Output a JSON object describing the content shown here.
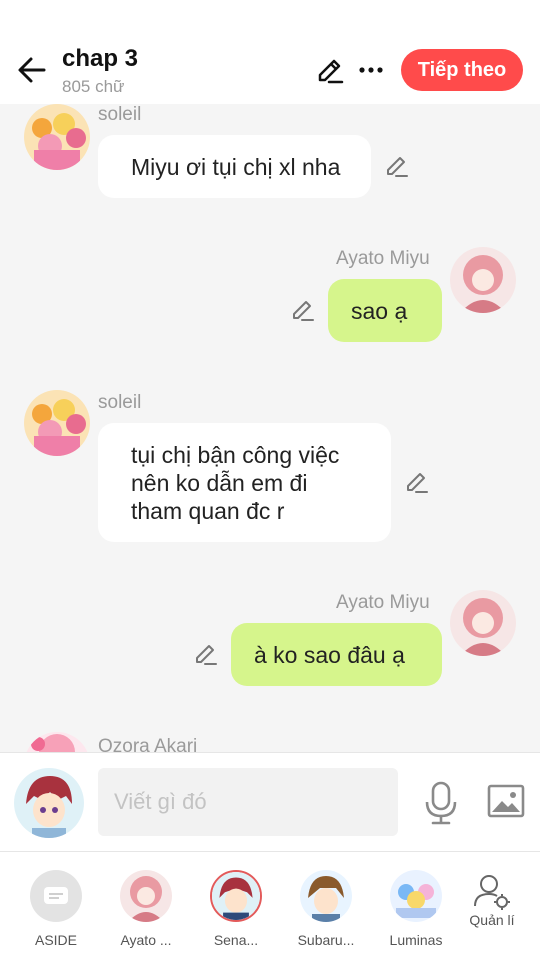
{
  "header": {
    "title": "chap 3",
    "word_count": "805 chữ",
    "next_label": "Tiếp theo"
  },
  "messages": [
    {
      "side": "left",
      "name": "soleil",
      "text": "Miyu ơi tụi chị xl nha"
    },
    {
      "side": "right",
      "name": "Ayato  Miyu",
      "text": "sao ạ"
    },
    {
      "side": "left",
      "name": "soleil",
      "text_lines": [
        "tụi chị bận công việc",
        "nên ko dẫn em đi",
        "tham quan đc r"
      ]
    },
    {
      "side": "right",
      "name": "Ayato  Miyu",
      "text": "à ko sao đâu ạ"
    },
    {
      "side": "left",
      "name": "Ozora Akari"
    }
  ],
  "composer": {
    "placeholder": "Viết gì đó"
  },
  "tabs": [
    {
      "label": "ASIDE"
    },
    {
      "label": "Ayato ..."
    },
    {
      "label": "Sena..."
    },
    {
      "label": "Subaru..."
    },
    {
      "label": "Luminas"
    },
    {
      "label": "Quản lí"
    }
  ],
  "colors": {
    "accent": "#ff4b4b",
    "right_bubble": "#d6f58c",
    "chat_bg": "#f5f5f5"
  }
}
